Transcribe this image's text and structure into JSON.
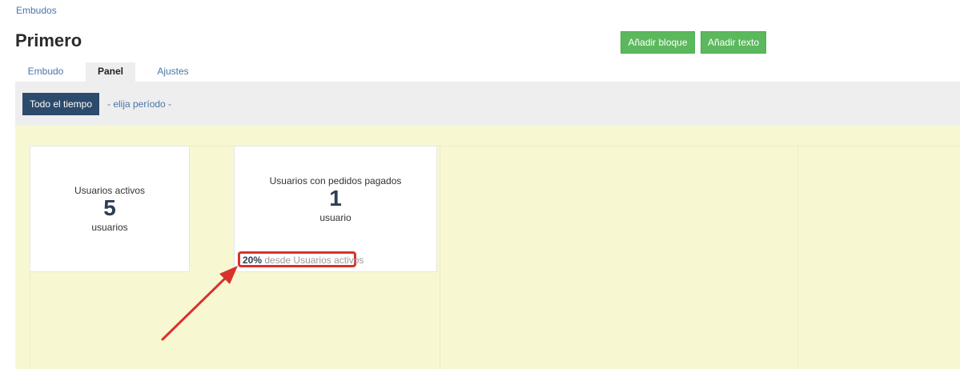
{
  "breadcrumb": {
    "label": "Embudos"
  },
  "header": {
    "title": "Primero",
    "add_block_label": "Añadir bloque",
    "add_text_label": "Añadir texto"
  },
  "tabs": [
    {
      "label": "Embudo",
      "active": false
    },
    {
      "label": "Panel",
      "active": true
    },
    {
      "label": "Ajustes",
      "active": false
    }
  ],
  "period": {
    "selected_label": "Todo el tiempo",
    "choose_label": "- elija período -"
  },
  "widgets": [
    {
      "title": "Usuarios activos",
      "value": "5",
      "unit": "usuarios"
    },
    {
      "title": "Usuarios con pedidos pagados",
      "value": "1",
      "unit": "usuario",
      "conversion_pct": "20%",
      "conversion_text": "desde Usuarios activos"
    }
  ],
  "colors": {
    "accent_green": "#5cb85c",
    "period_button": "#2c4a6b",
    "dashboard_bg": "#f7f8d2",
    "annotation_red": "#d9312c"
  }
}
